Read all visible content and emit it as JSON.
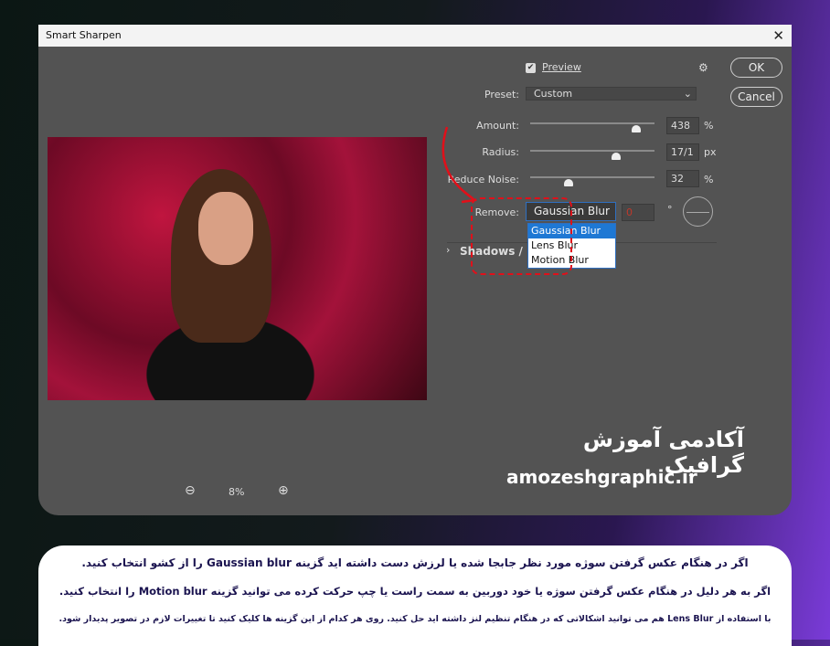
{
  "dialog": {
    "title": "Smart Sharpen",
    "close": "✕",
    "preview_label": "Preview",
    "preview_checked": true,
    "ok": "OK",
    "cancel": "Cancel",
    "preset_label": "Preset:",
    "preset_value": "Custom",
    "amount": {
      "label": "Amount:",
      "value": "438",
      "unit": "%",
      "level": 0.85
    },
    "radius": {
      "label": "Radius:",
      "value": "17/1",
      "unit": "px",
      "level": 0.69
    },
    "reduce_noise": {
      "label": "Reduce Noise:",
      "value": "32",
      "unit": "%",
      "level": 0.31
    },
    "remove_label": "Remove:",
    "remove_value": "Gaussian Blur",
    "angle_value": "0",
    "angle_unit": "°",
    "remove_options": [
      "Gaussian Blur",
      "Lens Blur",
      "Motion Blur"
    ],
    "shadows_label": "Shadows / H",
    "zoom_level": "8%"
  },
  "branding": {
    "title": "آکادمی آموزش گرافیک",
    "url": "amozeshgraphic.ir"
  },
  "caption": {
    "line1": "اگر در هنگام عکس گرفتن سوژه مورد نظر جابجا شده یا لرزش دست داشته اید گزینه Gaussian blur را از کشو انتخاب کنید.",
    "line2": "اگر به هر دلیل در هنگام عکس گرفتن سوژه یا خود دوربین به سمت راست یا چپ حرکت کرده می توانید گزینه Motion blur را انتخاب کنید.",
    "line3": "با استفاده از Lens Blur هم می توانید اشکالاتی که در هنگام تنظیم لنز داشته اید حل کنید. روی هر کدام از این گزینه ها کلیک کنید تا تغییرات لازم در تصویر پدیدار شود."
  },
  "colors": {
    "highlight": "#e0101a",
    "accent": "#1e78d4"
  }
}
